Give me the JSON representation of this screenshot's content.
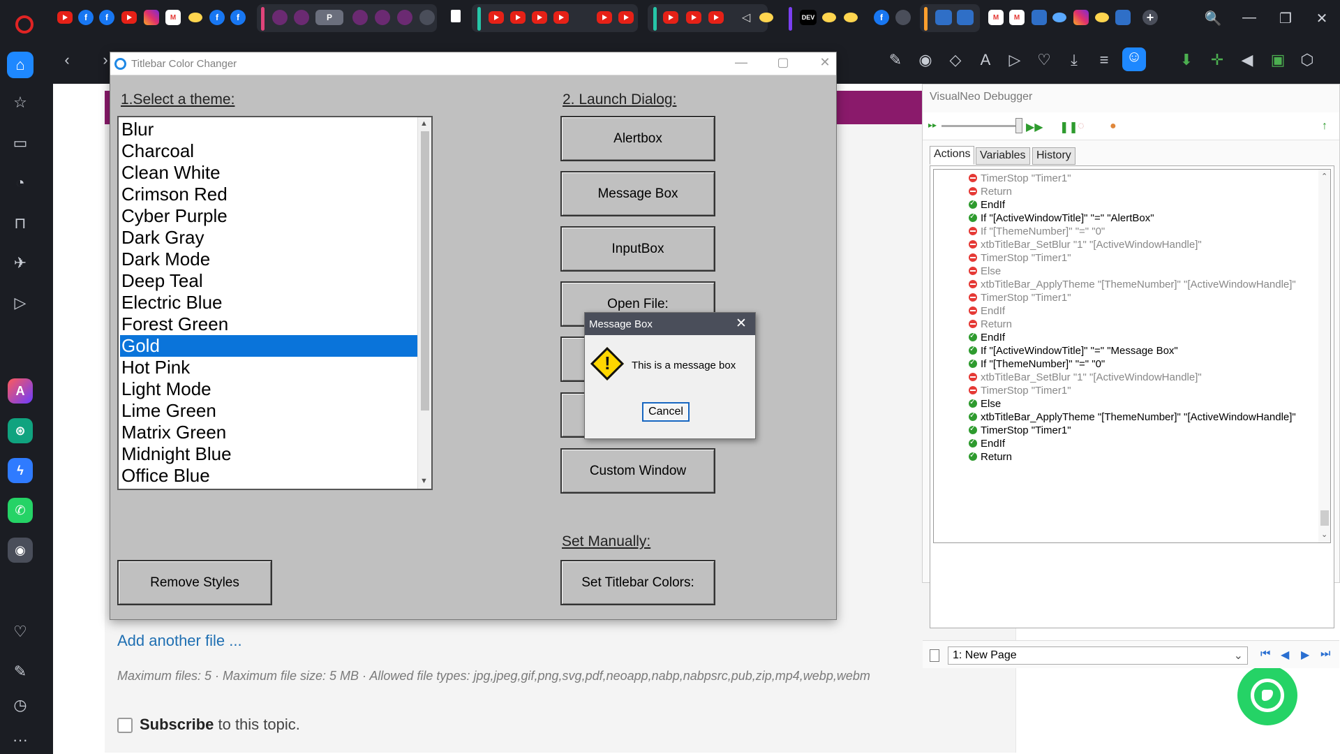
{
  "browser": {
    "window_controls": [
      "🔍",
      "—",
      "❐",
      "✕"
    ],
    "sidebar_icons": [
      "home",
      "star",
      "briefcase",
      "history-pie",
      "bag",
      "plane",
      "video",
      "aria",
      "chatgpt",
      "messenger",
      "whatsapp",
      "player",
      "heart",
      "edit",
      "clock",
      "more"
    ]
  },
  "webpage": {
    "add_file": "Add another file ...",
    "max_info": "Maximum files: 5 · Maximum file size: 5 MB · Allowed file types: jpg,jpeg,gif,png,svg,pdf,neoapp,nabp,nabpsrc,pub,zip,mp4,webp,webm",
    "subscribe_bold": "Subscribe",
    "subscribe_rest": " to this topic."
  },
  "tcc": {
    "title": "Titlebar Color Changer",
    "select_label": "1.Select a theme:",
    "launch_label": "2. Launch Dialog:",
    "manual_label": "Set Manually:",
    "themes": [
      "Blur",
      "Charcoal",
      "Clean White",
      "Crimson Red",
      "Cyber Purple",
      "Dark Gray",
      "Dark Mode",
      "Deep Teal",
      "Electric Blue",
      "Forest Green",
      "Gold",
      "Hot Pink",
      "Light Mode",
      "Lime Green",
      "Matrix Green",
      "Midnight Blue",
      "Office Blue"
    ],
    "selected_theme": "Gold",
    "buttons": {
      "alertbox": "Alertbox",
      "message_box": "Message Box",
      "inputbox": "InputBox",
      "open_file": "Open File:",
      "custom_window": "Custom Window",
      "remove_styles": "Remove Styles",
      "set_titlebar": "Set Titlebar Colors:"
    }
  },
  "msgbox": {
    "title": "Message Box",
    "text": "This is a message box",
    "cancel": "Cancel"
  },
  "debugger": {
    "title": "VisualNeo Debugger",
    "tabs": [
      "Actions",
      "Variables",
      "History"
    ],
    "lines": [
      {
        "status": "red",
        "text": "TimerStop \"Timer1\""
      },
      {
        "status": "red",
        "text": "Return"
      },
      {
        "status": "green",
        "text": "EndIf"
      },
      {
        "status": "green",
        "text": "If \"[ActiveWindowTitle]\" \"=\" \"AlertBox\""
      },
      {
        "status": "red",
        "text": "If \"[ThemeNumber]\" \"=\" \"0\""
      },
      {
        "status": "red",
        "text": "xtbTitleBar_SetBlur \"1\" \"[ActiveWindowHandle]\""
      },
      {
        "status": "red",
        "text": "TimerStop \"Timer1\""
      },
      {
        "status": "red",
        "text": "Else"
      },
      {
        "status": "red",
        "text": "xtbTitleBar_ApplyTheme \"[ThemeNumber]\" \"[ActiveWindowHandle]\""
      },
      {
        "status": "red",
        "text": "TimerStop \"Timer1\""
      },
      {
        "status": "red",
        "text": "EndIf"
      },
      {
        "status": "red",
        "text": "Return"
      },
      {
        "status": "green",
        "text": "EndIf"
      },
      {
        "status": "green",
        "text": "If \"[ActiveWindowTitle]\" \"=\" \"Message Box\""
      },
      {
        "status": "green",
        "text": "If \"[ThemeNumber]\" \"=\" \"0\""
      },
      {
        "status": "red",
        "text": "xtbTitleBar_SetBlur \"1\" \"[ActiveWindowHandle]\""
      },
      {
        "status": "red",
        "text": "TimerStop \"Timer1\""
      },
      {
        "status": "green",
        "text": "Else"
      },
      {
        "status": "green",
        "text": "xtbTitleBar_ApplyTheme \"[ThemeNumber]\" \"[ActiveWindowHandle]\""
      },
      {
        "status": "green",
        "text": "TimerStop \"Timer1\""
      },
      {
        "status": "green",
        "text": "EndIf"
      },
      {
        "status": "green",
        "text": "Return"
      }
    ],
    "page_select": "1: New Page"
  },
  "colors": {
    "accent_blue": "#1e88ff",
    "selection": "#0a74da",
    "window_gray": "#c0c0c0",
    "brand_band": "#8a1a6b",
    "whatsapp": "#25d366"
  }
}
